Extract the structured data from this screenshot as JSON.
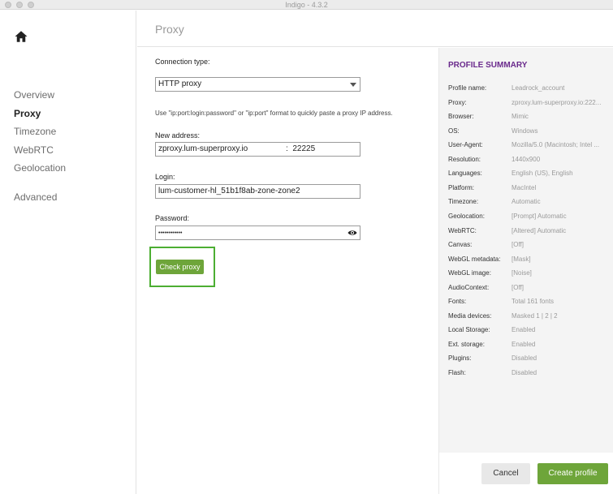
{
  "window": {
    "title": "Indigo - 4.3.2"
  },
  "sidebar": {
    "home_icon": "home-icon",
    "items": [
      {
        "label": "Overview",
        "active": false
      },
      {
        "label": "Proxy",
        "active": true
      },
      {
        "label": "Timezone",
        "active": false
      },
      {
        "label": "WebRTC",
        "active": false
      },
      {
        "label": "Geolocation",
        "active": false
      },
      {
        "label": "Advanced",
        "active": false
      }
    ]
  },
  "header": {
    "title": "Proxy"
  },
  "form": {
    "connection_type_label": "Connection type:",
    "connection_type_value": "HTTP proxy",
    "hint": "Use \"ip:port:login:password\" or \"ip:port\" format to quickly paste a proxy IP address.",
    "new_address_label": "New address:",
    "address_host": "zproxy.lum-superproxy.io",
    "address_separator": ":",
    "address_port": "22225",
    "login_label": "Login:",
    "login_value": "lum-customer-hl_51b1f8ab-zone-zone2",
    "password_label": "Password:",
    "password_value": "••••••••••••",
    "check_proxy_label": "Check proxy"
  },
  "summary": {
    "title": "PROFILE SUMMARY",
    "rows": [
      {
        "key": "Profile name:",
        "value": "Leadrock_account"
      },
      {
        "key": "Proxy:",
        "value": "zproxy.lum-superproxy.io:222..."
      },
      {
        "key": "Browser:",
        "value": "Mimic"
      },
      {
        "key": "OS:",
        "value": "Windows"
      },
      {
        "key": "User-Agent:",
        "value": "Mozilla/5.0 (Macintosh; Intel ..."
      },
      {
        "key": "Resolution:",
        "value": "1440x900"
      },
      {
        "key": "Languages:",
        "value": "English (US), English"
      },
      {
        "key": "Platform:",
        "value": "MacIntel"
      },
      {
        "key": "Timezone:",
        "value": "Automatic"
      },
      {
        "key": "Geolocation:",
        "value": "[Prompt] Automatic"
      },
      {
        "key": "WebRTC:",
        "value": "[Altered] Automatic"
      },
      {
        "key": "Canvas:",
        "value": "[Off]"
      },
      {
        "key": "WebGL metadata:",
        "value": "[Mask]"
      },
      {
        "key": "WebGL image:",
        "value": "[Noise]"
      },
      {
        "key": "AudioContext:",
        "value": "[Off]"
      },
      {
        "key": "Fonts:",
        "value": "Total 161 fonts"
      },
      {
        "key": "Media devices:",
        "value": "Masked 1 | 2 | 2"
      },
      {
        "key": "Local Storage:",
        "value": "Enabled"
      },
      {
        "key": "Ext. storage:",
        "value": "Enabled"
      },
      {
        "key": "Plugins:",
        "value": "Disabled"
      },
      {
        "key": "Flash:",
        "value": "Disabled"
      }
    ]
  },
  "footer": {
    "cancel_label": "Cancel",
    "create_label": "Create profile"
  },
  "colors": {
    "accent_green": "#6ea53a",
    "highlight_green": "#4cae32",
    "summary_title_purple": "#6a2a8c"
  }
}
